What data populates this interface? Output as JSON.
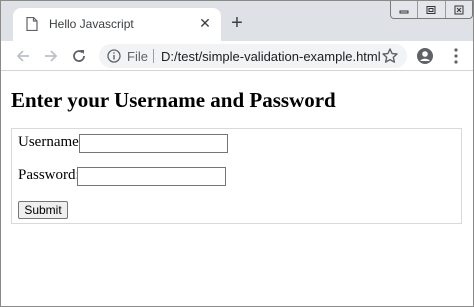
{
  "tab": {
    "title": "Hello Javascript",
    "close_icon": "close-icon",
    "favicon": "page-icon"
  },
  "new_tab": {
    "label": "+"
  },
  "toolbar": {
    "back_icon": "arrow-left-icon",
    "forward_icon": "arrow-right-icon",
    "reload_icon": "reload-icon",
    "omnibox": {
      "scheme_label": "File",
      "url": "D:/test/simple-validation-example.html"
    },
    "bookmark_icon": "star-icon",
    "account_icon": "account-icon",
    "menu_icon": "vertical-dots-icon"
  },
  "page": {
    "heading": "Enter your Username and Password",
    "form": {
      "username_label": "Username:",
      "username_value": "",
      "password_label": "Password:",
      "password_value": "",
      "submit_label": "Submit"
    }
  }
}
